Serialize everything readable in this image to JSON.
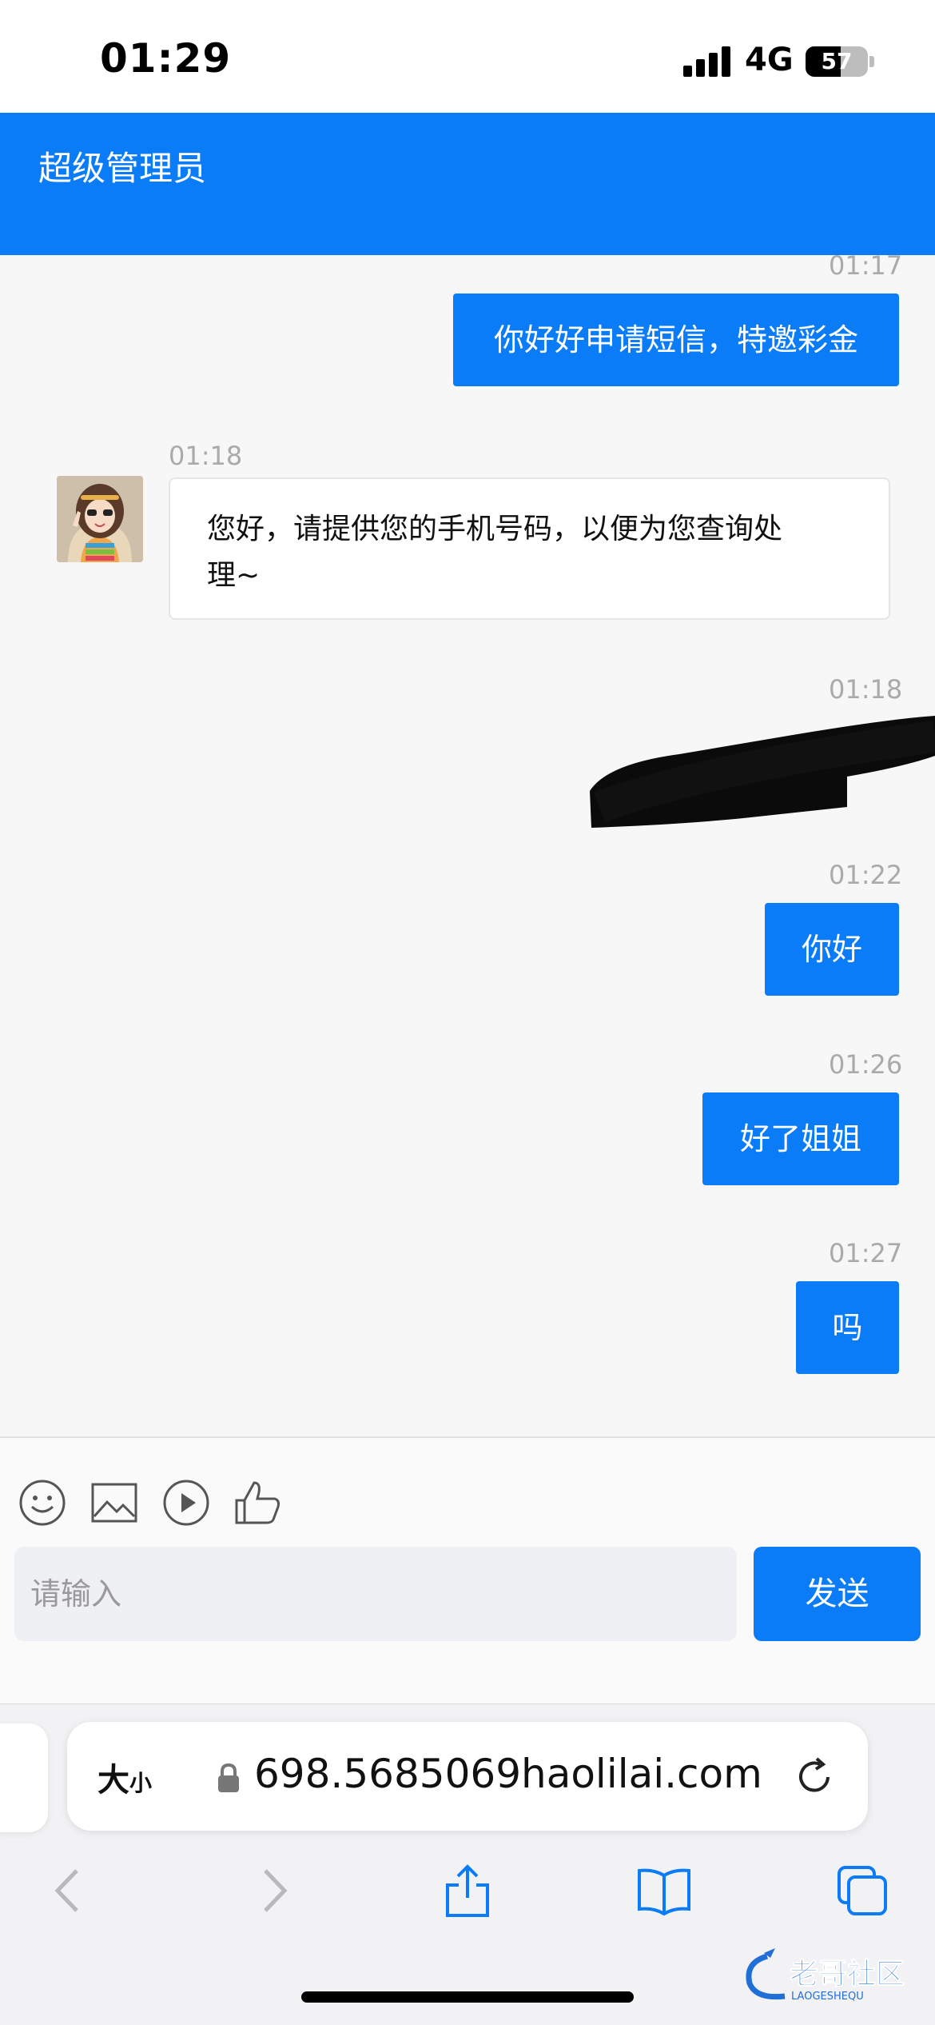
{
  "status_bar": {
    "time": "01:29",
    "network": "4G",
    "battery": "57"
  },
  "header": {
    "title": "超级管理员"
  },
  "messages": [
    {
      "time": "01:17",
      "text": "你好好申请短信，特邀彩金",
      "direction": "out"
    },
    {
      "time": "01:18",
      "text_line1": "您好，请提供您的手机号码，以便为您查询处",
      "text_line2": "理~",
      "direction": "in"
    },
    {
      "time": "01:18",
      "text": "",
      "direction": "out",
      "redacted": true
    },
    {
      "time": "01:22",
      "text": "你好",
      "direction": "out"
    },
    {
      "time": "01:26",
      "text": "好了姐姐",
      "direction": "out"
    },
    {
      "time": "01:27",
      "text": "吗",
      "direction": "out"
    }
  ],
  "toolbar": {
    "icons": [
      "emoji-icon",
      "image-icon",
      "video-icon",
      "thumbs-up-icon"
    ]
  },
  "composer": {
    "placeholder": "请输入",
    "send_label": "发送"
  },
  "browser": {
    "text_size_label": "大",
    "text_size_label_small": "小",
    "url": "698.5685069haolilai.com"
  },
  "watermark": {
    "text": "老哥社区",
    "subtext": "LAOGESHEQU"
  },
  "colors": {
    "accent": "#0a7cf7",
    "bubble_in": "#ffffff",
    "background": "#f7f7f7"
  }
}
